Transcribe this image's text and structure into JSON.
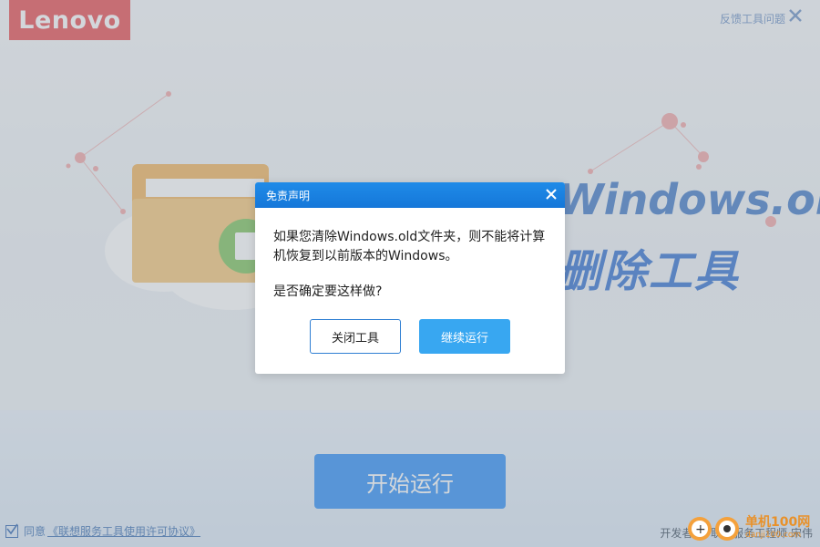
{
  "app": {
    "logo_text": "Lenovo",
    "feedback_label": "反馈工具问题",
    "hero_title_line1": "Windows.old",
    "hero_title_line2": "删除工具",
    "start_button": "开始运行",
    "agree_prefix": "同意",
    "agree_link": "《联想服务工具使用许可协议》",
    "developer_label": "开发者：",
    "developer_name": "联想服务工程师 宋伟"
  },
  "watermark": {
    "title": "单机100网",
    "subtitle": "danji100.com"
  },
  "dialog": {
    "title": "免责声明",
    "message": "如果您清除Windows.old文件夹，则不能将计算机恢复到以前版本的Windows。",
    "question": "是否确定要这样做?",
    "close_button": "关闭工具",
    "continue_button": "继续运行"
  },
  "colors": {
    "brand_red": "#e84a4f",
    "accent_blue": "#1f8be8",
    "primary_button": "#38a7f1"
  },
  "icons": {
    "main_close": "close-icon",
    "dialog_close": "close-icon",
    "checkbox": "checkbox-checked-icon",
    "illustration": "folder-trash-icon"
  }
}
